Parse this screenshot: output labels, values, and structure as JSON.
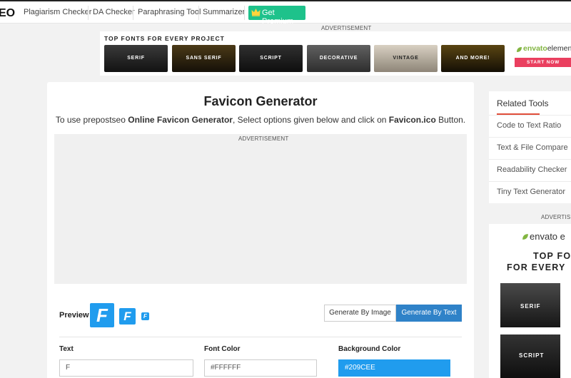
{
  "topbar": {
    "logo": "EO",
    "nav": [
      "Plagiarism Checker",
      "DA Checker",
      "Paraphrasing Tool",
      "Summarizer"
    ],
    "premium_label": "Get Premium"
  },
  "ad_label": "ADVERTISEMENT",
  "banner": {
    "title": "TOP FONTS FOR EVERY PROJECT",
    "tiles": [
      "SERIF",
      "SANS SERIF",
      "SCRIPT",
      "DECORATIVE",
      "VINTAGE",
      "AND MORE!"
    ],
    "brand_prefix": "envato",
    "brand_suffix": "elements",
    "cta": "START NOW"
  },
  "main": {
    "title": "Favicon Generator",
    "intro_pre": "To use prepostseo ",
    "intro_bold1": "Online Favicon Generator",
    "intro_mid": ", Select options given below and click on ",
    "intro_bold2": "Favicon.ico",
    "intro_post": " Button.",
    "preview_label": "Preview",
    "preview_letter": "F",
    "buttons": {
      "by_image": "Generate By Image",
      "by_text": "Generate By Text"
    },
    "fields": {
      "text_label": "Text",
      "text_value": "F",
      "font_color_label": "Font Color",
      "font_color_value": "#FFFFFF",
      "bg_color_label": "Background Color",
      "bg_color_value": "#209CEE"
    }
  },
  "sidebar": {
    "title": "Related Tools",
    "items": [
      "Code to Text Ratio",
      "Text & File Compare",
      "Readability Checker",
      "Tiny Text Generator"
    ]
  },
  "side_ad": {
    "label": "ADVERTISE",
    "brand": "envato e",
    "line1": "TOP FO",
    "line2": "FOR EVERY",
    "tiles": [
      "SERIF",
      "SCRIPT"
    ]
  },
  "colors": {
    "accent": "#209cee",
    "premium": "#1ec28b",
    "active_button": "#2f82c8",
    "sidebar_underline": "#e04e3a",
    "cta": "#ea3f5f"
  }
}
